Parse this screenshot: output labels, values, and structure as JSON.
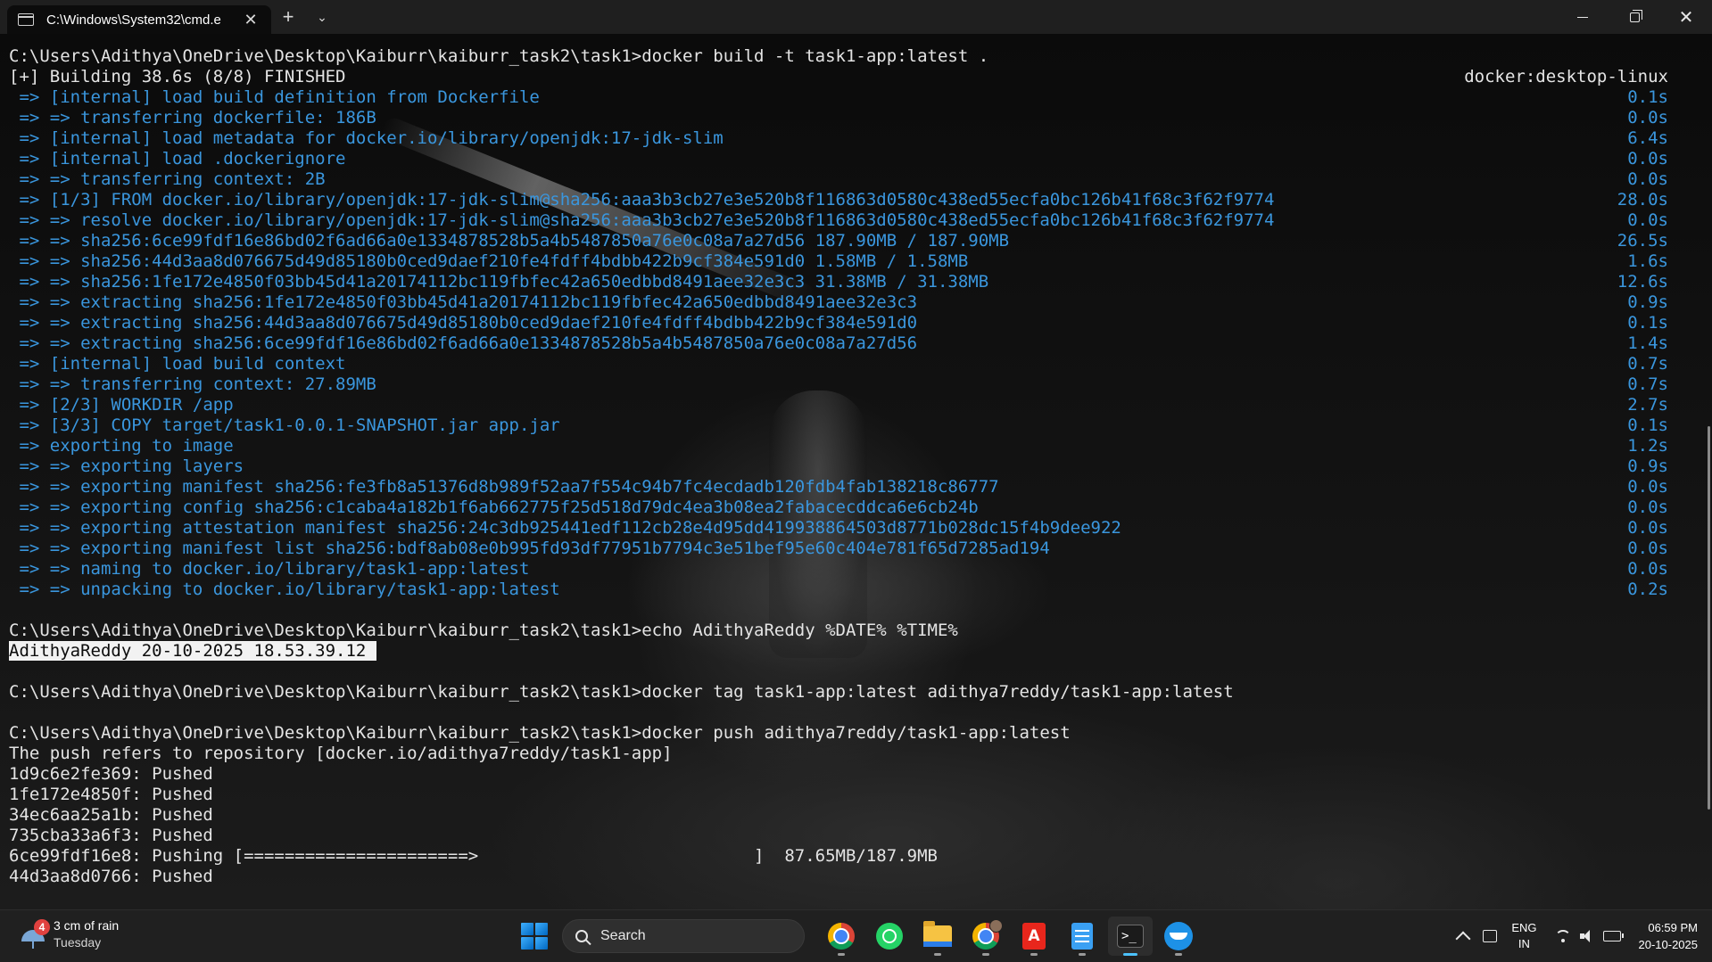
{
  "window": {
    "tab_title": "C:\\Windows\\System32\\cmd.e",
    "tab_close": "✕",
    "new_tab": "+",
    "dropdown": "⌄",
    "close": "✕"
  },
  "terminal": {
    "lines": [
      {
        "text": "C:\\Users\\Adithya\\OneDrive\\Desktop\\Kaiburr\\kaiburr_task2\\task1>docker build -t task1-app:latest .",
        "color": "w"
      },
      {
        "text": "[+] Building 38.6s (8/8) FINISHED",
        "right": "docker:desktop-linux",
        "color": "w"
      },
      {
        "text": " => [internal] load build definition from Dockerfile",
        "right": "0.1s",
        "color": "b"
      },
      {
        "text": " => => transferring dockerfile: 186B",
        "right": "0.0s",
        "color": "b"
      },
      {
        "text": " => [internal] load metadata for docker.io/library/openjdk:17-jdk-slim",
        "right": "6.4s",
        "color": "b"
      },
      {
        "text": " => [internal] load .dockerignore",
        "right": "0.0s",
        "color": "b"
      },
      {
        "text": " => => transferring context: 2B",
        "right": "0.0s",
        "color": "b"
      },
      {
        "text": " => [1/3] FROM docker.io/library/openjdk:17-jdk-slim@sha256:aaa3b3cb27e3e520b8f116863d0580c438ed55ecfa0bc126b41f68c3f62f9774",
        "right": "28.0s",
        "color": "b"
      },
      {
        "text": " => => resolve docker.io/library/openjdk:17-jdk-slim@sha256:aaa3b3cb27e3e520b8f116863d0580c438ed55ecfa0bc126b41f68c3f62f9774",
        "right": "0.0s",
        "color": "b"
      },
      {
        "text": " => => sha256:6ce99fdf16e86bd02f6ad66a0e1334878528b5a4b5487850a76e0c08a7a27d56 187.90MB / 187.90MB",
        "right": "26.5s",
        "color": "b"
      },
      {
        "text": " => => sha256:44d3aa8d076675d49d85180b0ced9daef210fe4fdff4bdbb422b9cf384e591d0 1.58MB / 1.58MB",
        "right": "1.6s",
        "color": "b"
      },
      {
        "text": " => => sha256:1fe172e4850f03bb45d41a20174112bc119fbfec42a650edbbd8491aee32e3c3 31.38MB / 31.38MB",
        "right": "12.6s",
        "color": "b"
      },
      {
        "text": " => => extracting sha256:1fe172e4850f03bb45d41a20174112bc119fbfec42a650edbbd8491aee32e3c3",
        "right": "0.9s",
        "color": "b"
      },
      {
        "text": " => => extracting sha256:44d3aa8d076675d49d85180b0ced9daef210fe4fdff4bdbb422b9cf384e591d0",
        "right": "0.1s",
        "color": "b"
      },
      {
        "text": " => => extracting sha256:6ce99fdf16e86bd02f6ad66a0e1334878528b5a4b5487850a76e0c08a7a27d56",
        "right": "1.4s",
        "color": "b"
      },
      {
        "text": " => [internal] load build context",
        "right": "0.7s",
        "color": "b"
      },
      {
        "text": " => => transferring context: 27.89MB",
        "right": "0.7s",
        "color": "b"
      },
      {
        "text": " => [2/3] WORKDIR /app",
        "right": "2.7s",
        "color": "b"
      },
      {
        "text": " => [3/3] COPY target/task1-0.0.1-SNAPSHOT.jar app.jar",
        "right": "0.1s",
        "color": "b"
      },
      {
        "text": " => exporting to image",
        "right": "1.2s",
        "color": "b"
      },
      {
        "text": " => => exporting layers",
        "right": "0.9s",
        "color": "b"
      },
      {
        "text": " => => exporting manifest sha256:fe3fb8a51376d8b989f52aa7f554c94b7fc4ecdadb120fdb4fab138218c86777",
        "right": "0.0s",
        "color": "b"
      },
      {
        "text": " => => exporting config sha256:c1caba4a182b1f6ab662775f25d518d79dc4ea3b08ea2fabacecddca6e6cb24b",
        "right": "0.0s",
        "color": "b"
      },
      {
        "text": " => => exporting attestation manifest sha256:24c3db925441edf112cb28e4d95dd419938864503d8771b028dc15f4b9dee922",
        "right": "0.0s",
        "color": "b"
      },
      {
        "text": " => => exporting manifest list sha256:bdf8ab08e0b995fd93df77951b7794c3e51bef95e60c404e781f65d7285ad194",
        "right": "0.0s",
        "color": "b"
      },
      {
        "text": " => => naming to docker.io/library/task1-app:latest",
        "right": "0.0s",
        "color": "b"
      },
      {
        "text": " => => unpacking to docker.io/library/task1-app:latest",
        "right": "0.2s",
        "color": "b"
      },
      {
        "text": "",
        "color": "w"
      },
      {
        "text": "C:\\Users\\Adithya\\OneDrive\\Desktop\\Kaiburr\\kaiburr_task2\\task1>echo AdithyaReddy %DATE% %TIME%",
        "color": "w"
      },
      {
        "text": "AdithyaReddy 20-10-2025 18.53.39.12 ",
        "color": "w",
        "highlight": true
      },
      {
        "text": "",
        "color": "w"
      },
      {
        "text": "C:\\Users\\Adithya\\OneDrive\\Desktop\\Kaiburr\\kaiburr_task2\\task1>docker tag task1-app:latest adithya7reddy/task1-app:latest",
        "color": "w"
      },
      {
        "text": "",
        "color": "w"
      },
      {
        "text": "C:\\Users\\Adithya\\OneDrive\\Desktop\\Kaiburr\\kaiburr_task2\\task1>docker push adithya7reddy/task1-app:latest",
        "color": "w"
      },
      {
        "text": "The push refers to repository [docker.io/adithya7reddy/task1-app]",
        "color": "w"
      },
      {
        "text": "1d9c6e2fe369: Pushed",
        "color": "w"
      },
      {
        "text": "1fe172e4850f: Pushed",
        "color": "w"
      },
      {
        "text": "34ec6aa25a1b: Pushed",
        "color": "w"
      },
      {
        "text": "735cba33a6f3: Pushed",
        "color": "w"
      },
      {
        "text": "6ce99fdf16e8: Pushing [======================>                           ]  87.65MB/187.9MB",
        "color": "w"
      },
      {
        "text": "44d3aa8d0766: Pushed",
        "color": "w"
      }
    ]
  },
  "taskbar": {
    "weather_badge": "4",
    "weather_title": "3 cm of rain",
    "weather_day": "Tuesday",
    "search_label": "Search",
    "pdf_label": "A",
    "terminal_label": ">_",
    "lang_top": "ENG",
    "lang_bottom": "IN",
    "time": "06:59 PM",
    "date": "20-10-2025"
  },
  "colors": {
    "terminal_text": "#e4e4e4",
    "terminal_blue": "#3a96dd",
    "highlight_bg": "#f2f2f2",
    "accent": "#4cc2ff"
  }
}
